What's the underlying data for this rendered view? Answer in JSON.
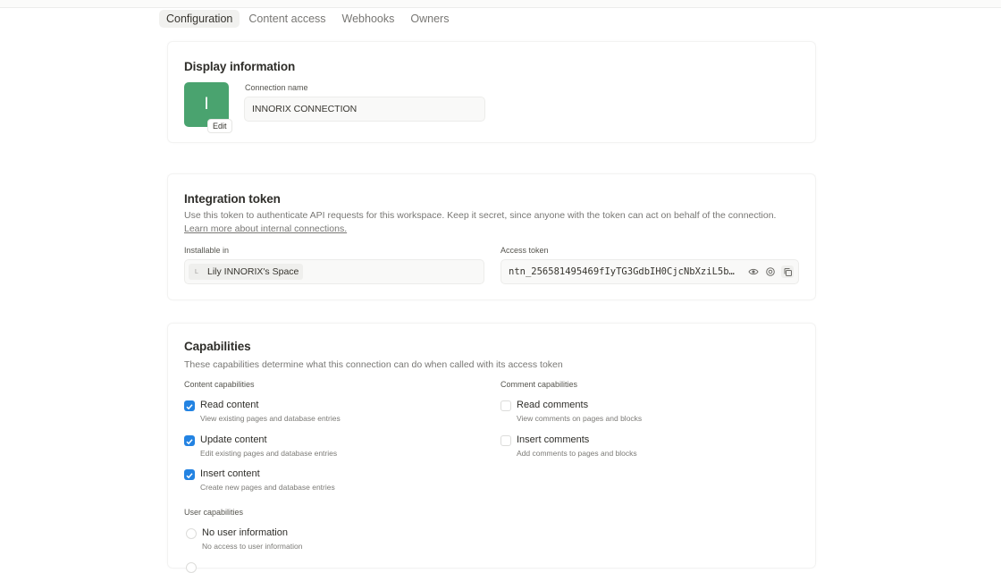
{
  "tabs": [
    "Configuration",
    "Content access",
    "Webhooks",
    "Owners"
  ],
  "display": {
    "title": "Display information",
    "avatar_letter": "I",
    "edit_label": "Edit",
    "name_label": "Connection name",
    "name_value": "INNORIX CONNECTION"
  },
  "token": {
    "title": "Integration token",
    "desc": "Use this token to authenticate API requests for this workspace. Keep it secret, since anyone with the token can act on behalf of the connection.",
    "learn_more": "Learn more about internal connections.",
    "installable_label": "Installable in",
    "workspace_initial": "L",
    "workspace_name": "Lily INNORIX's Space",
    "access_label": "Access token",
    "access_value": "ntn_256581495469fIyTG3GdbIH0CjcNbXziL5b…"
  },
  "capabilities": {
    "title": "Capabilities",
    "desc": "These capabilities determine what this connection can do when called with its access token",
    "content_label": "Content capabilities",
    "comment_label": "Comment capabilities",
    "user_label": "User capabilities",
    "content": [
      {
        "title": "Read content",
        "sub": "View existing pages and database entries",
        "checked": true
      },
      {
        "title": "Update content",
        "sub": "Edit existing pages and database entries",
        "checked": true
      },
      {
        "title": "Insert content",
        "sub": "Create new pages and database entries",
        "checked": true
      }
    ],
    "comment": [
      {
        "title": "Read comments",
        "sub": "View comments on pages and blocks",
        "checked": false
      },
      {
        "title": "Insert comments",
        "sub": "Add comments to pages and blocks",
        "checked": false
      }
    ],
    "user": [
      {
        "title": "No user information",
        "sub": "No access to user information",
        "checked": false
      }
    ]
  },
  "colors": {
    "accent": "#2383e2",
    "avatar": "#4aa36f"
  }
}
